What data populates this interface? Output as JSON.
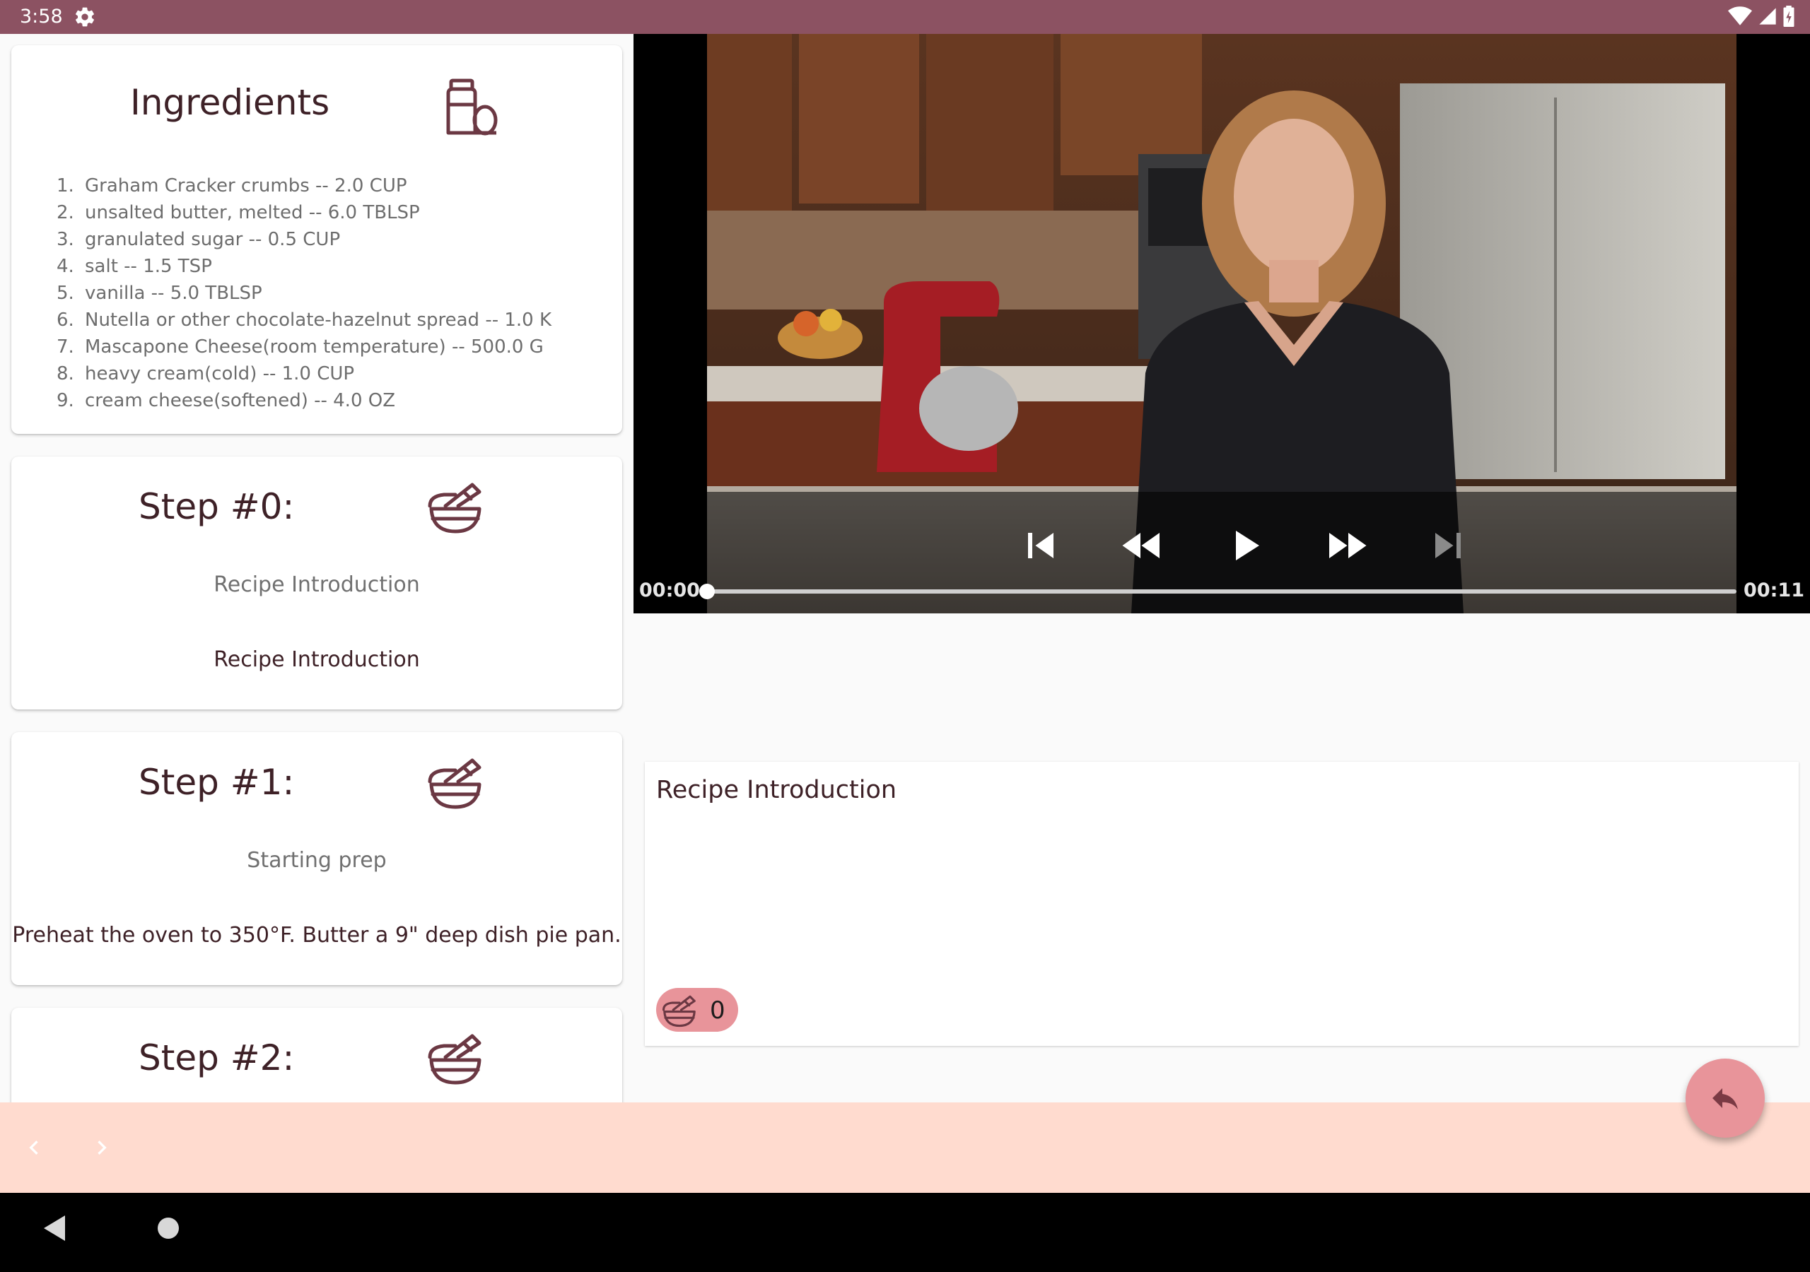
{
  "status_bar": {
    "time": "3:58",
    "icons": [
      "settings-gear-icon",
      "wifi-icon",
      "cellular-signal-icon",
      "battery-icon"
    ],
    "background_color": "#8c5262"
  },
  "ingredients": {
    "title": "Ingredients",
    "icon": "jar-and-egg-icon",
    "items": [
      {
        "num": "1.",
        "text": "Graham Cracker crumbs -- 2.0 CUP"
      },
      {
        "num": "2.",
        "text": "unsalted butter, melted -- 6.0 TBLSP"
      },
      {
        "num": "3.",
        "text": "granulated sugar -- 0.5 CUP"
      },
      {
        "num": "4.",
        "text": "salt -- 1.5 TSP"
      },
      {
        "num": "5.",
        "text": "vanilla -- 5.0 TBLSP"
      },
      {
        "num": "6.",
        "text": "Nutella or other chocolate-hazelnut spread -- 1.0 K"
      },
      {
        "num": "7.",
        "text": "Mascapone Cheese(room temperature) -- 500.0 G"
      },
      {
        "num": "8.",
        "text": "heavy cream(cold) -- 1.0 CUP"
      },
      {
        "num": "9.",
        "text": "cream cheese(softened) -- 4.0 OZ"
      }
    ]
  },
  "steps": [
    {
      "title": "Step #0:",
      "short": "Recipe Introduction",
      "description": "Recipe Introduction",
      "icon": "mixing-bowl-icon"
    },
    {
      "title": "Step #1:",
      "short": "Starting prep",
      "description": "Preheat the oven to 350°F. Butter a 9\" deep dish pie pan.",
      "icon": "mixing-bowl-icon"
    },
    {
      "title": "Step #2:",
      "icon": "mixing-bowl-icon"
    }
  ],
  "video": {
    "current_time": "00:00",
    "duration": "00:11",
    "progress": 0.0,
    "controls": [
      "skip-previous-icon",
      "rewind-icon",
      "play-icon",
      "fast-forward-icon",
      "skip-next-icon"
    ]
  },
  "detail": {
    "description": "Recipe Introduction",
    "step_chip_value": "0",
    "chip_icon": "mixing-bowl-icon"
  },
  "bottom_bar": {
    "prev_icon": "chevron-left-icon",
    "next_icon": "chevron-right-icon",
    "fab_icon": "reply-icon",
    "background_color": "#ffdbcf",
    "accent_color": "#e8949a"
  },
  "system_nav": [
    "back-icon",
    "home-icon"
  ]
}
